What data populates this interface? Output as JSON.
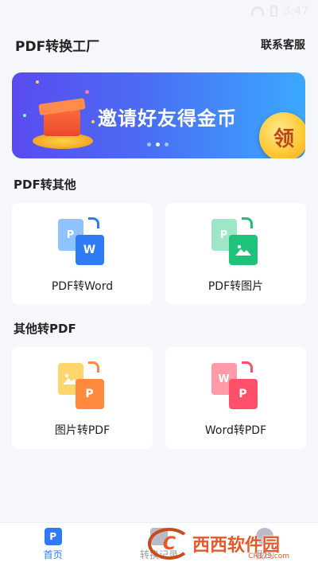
{
  "status": {
    "time": "3:47"
  },
  "header": {
    "title": "PDF转换工厂",
    "service": "联系客服"
  },
  "banner": {
    "text": "邀请好友得金币",
    "button": "领",
    "dots": 3,
    "active_dot": 1
  },
  "sections": [
    {
      "title": "PDF转其他",
      "cards": [
        {
          "label": "PDF转Word",
          "back_letter": "P",
          "front_letter": "W"
        },
        {
          "label": "PDF转图片",
          "back_letter": "P",
          "front_letter": ""
        }
      ]
    },
    {
      "title": "其他转PDF",
      "cards": [
        {
          "label": "图片转PDF",
          "back_letter": "",
          "front_letter": "P"
        },
        {
          "label": "Word转PDF",
          "back_letter": "W",
          "front_letter": "P"
        }
      ]
    }
  ],
  "tabs": [
    {
      "label": "首页",
      "icon_letter": "P",
      "active": true
    },
    {
      "label": "转换记录",
      "icon_letter": "",
      "active": false
    },
    {
      "label": "我的",
      "icon_letter": "",
      "active": false
    }
  ],
  "watermark": {
    "logo": "C",
    "text": "西西软件园",
    "sub": "CR173.com"
  },
  "colors": {
    "accent": "#2f7bf5",
    "bg": "#f5f7fb"
  }
}
